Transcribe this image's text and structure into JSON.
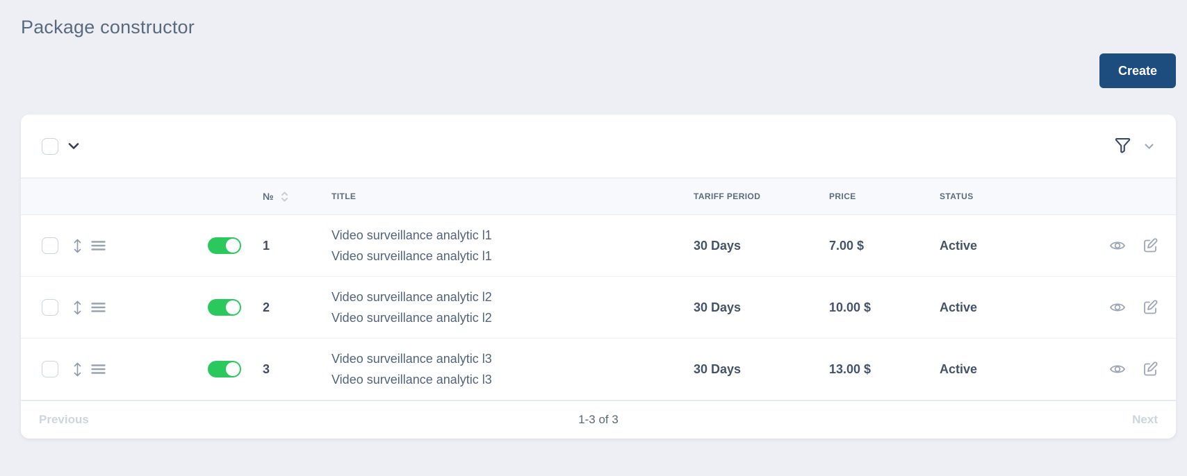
{
  "page": {
    "title": "Package constructor"
  },
  "actions": {
    "create": "Create"
  },
  "table": {
    "headers": {
      "number": "№",
      "title": "TITLE",
      "tariff_period": "TARIFF PERIOD",
      "price": "PRICE",
      "status": "STATUS"
    },
    "rows": [
      {
        "number": "1",
        "title_line1": "Video surveillance analytic l1",
        "title_line2": "Video surveillance analytic l1",
        "tariff_period": "30 Days",
        "price": "7.00 $",
        "status": "Active",
        "enabled": true
      },
      {
        "number": "2",
        "title_line1": "Video surveillance analytic l2",
        "title_line2": "Video surveillance analytic l2",
        "tariff_period": "30 Days",
        "price": "10.00 $",
        "status": "Active",
        "enabled": true
      },
      {
        "number": "3",
        "title_line1": "Video surveillance analytic l3",
        "title_line2": "Video surveillance analytic l3",
        "tariff_period": "30 Days",
        "price": "13.00 $",
        "status": "Active",
        "enabled": true
      }
    ]
  },
  "pagination": {
    "previous": "Previous",
    "range": "1-3 of 3",
    "next": "Next"
  },
  "icons": {
    "bulk_select_expand": "chevron-down-icon",
    "filter": "filter-funnel-icon",
    "filter_expand": "chevron-down-icon",
    "sort": "sort-arrows-icon",
    "drag": "drag-vertical-arrows-icon",
    "row_menu": "hamburger-menu-icon",
    "view": "eye-icon",
    "edit": "edit-pencil-icon"
  },
  "colors": {
    "accent": "#1d4c7f",
    "toggle_on": "#2bc85d",
    "page_background": "#edeff4",
    "card_background": "#ffffff"
  }
}
